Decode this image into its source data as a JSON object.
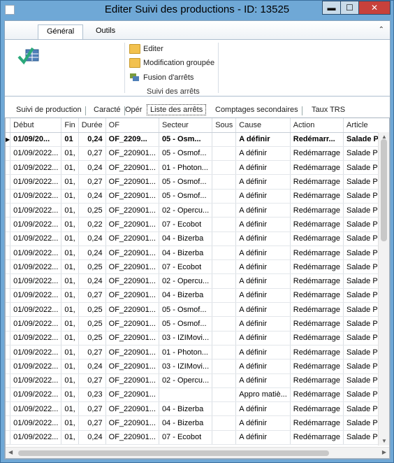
{
  "window": {
    "title": "Editer Suivi des productions - ID: 13525",
    "buttons": {
      "minimize": "▬",
      "maximize": "☐",
      "close": "✕"
    }
  },
  "ribbon": {
    "tabs": [
      "Général",
      "Outils"
    ],
    "items": [
      "Editer",
      "Modification groupée",
      "Fusion d'arrêts"
    ],
    "group_label": "Suivi des arrêts",
    "icons": [
      "checkmark-table-icon",
      "folder-icon",
      "folder-icon",
      "fusion-icon"
    ]
  },
  "page_tabs": [
    "Suivi de production",
    "Caracté",
    "Opér",
    "Liste des arrêts",
    "Comptages secondaires",
    "Taux TRS"
  ],
  "grid": {
    "columns": [
      "Début",
      "Fin",
      "Durée",
      "OF",
      "Secteur",
      "Sous",
      "Cause",
      "Action",
      "Article"
    ],
    "rows": [
      {
        "debut": "01/09/20...",
        "fin": "01",
        "duree": "0,24",
        "of": "OF_2209...",
        "secteur": "05 - Osm...",
        "sous": "",
        "cause": "A définir",
        "action": "Redémarr...",
        "article": "Salade Po"
      },
      {
        "debut": "01/09/2022...",
        "fin": "01,",
        "duree": "0,27",
        "of": "OF_220901...",
        "secteur": "05 - Osmof...",
        "sous": "",
        "cause": "A définir",
        "action": "Redémarrage",
        "article": "Salade Poul"
      },
      {
        "debut": "01/09/2022...",
        "fin": "01,",
        "duree": "0,24",
        "of": "OF_220901...",
        "secteur": "01 - Photon...",
        "sous": "",
        "cause": "A définir",
        "action": "Redémarrage",
        "article": "Salade Poul"
      },
      {
        "debut": "01/09/2022...",
        "fin": "01,",
        "duree": "0,27",
        "of": "OF_220901...",
        "secteur": "05 - Osmof...",
        "sous": "",
        "cause": "A définir",
        "action": "Redémarrage",
        "article": "Salade Poul"
      },
      {
        "debut": "01/09/2022...",
        "fin": "01,",
        "duree": "0,24",
        "of": "OF_220901...",
        "secteur": "05 - Osmof...",
        "sous": "",
        "cause": "A définir",
        "action": "Redémarrage",
        "article": "Salade Poul"
      },
      {
        "debut": "01/09/2022...",
        "fin": "01,",
        "duree": "0,25",
        "of": "OF_220901...",
        "secteur": "02 - Opercu...",
        "sous": "",
        "cause": "A définir",
        "action": "Redémarrage",
        "article": "Salade Poul"
      },
      {
        "debut": "01/09/2022...",
        "fin": "01,",
        "duree": "0,22",
        "of": "OF_220901...",
        "secteur": "07 - Ecobot",
        "sous": "",
        "cause": "A définir",
        "action": "Redémarrage",
        "article": "Salade Poul"
      },
      {
        "debut": "01/09/2022...",
        "fin": "01,",
        "duree": "0,24",
        "of": "OF_220901...",
        "secteur": "04 - Bizerba",
        "sous": "",
        "cause": "A définir",
        "action": "Redémarrage",
        "article": "Salade Poul"
      },
      {
        "debut": "01/09/2022...",
        "fin": "01,",
        "duree": "0,24",
        "of": "OF_220901...",
        "secteur": "04 - Bizerba",
        "sous": "",
        "cause": "A définir",
        "action": "Redémarrage",
        "article": "Salade Poul"
      },
      {
        "debut": "01/09/2022...",
        "fin": "01,",
        "duree": "0,25",
        "of": "OF_220901...",
        "secteur": "07 - Ecobot",
        "sous": "",
        "cause": "A définir",
        "action": "Redémarrage",
        "article": "Salade Poul"
      },
      {
        "debut": "01/09/2022...",
        "fin": "01,",
        "duree": "0,24",
        "of": "OF_220901...",
        "secteur": "02 - Opercu...",
        "sous": "",
        "cause": "A définir",
        "action": "Redémarrage",
        "article": "Salade Poul"
      },
      {
        "debut": "01/09/2022...",
        "fin": "01,",
        "duree": "0,27",
        "of": "OF_220901...",
        "secteur": "04 - Bizerba",
        "sous": "",
        "cause": "A définir",
        "action": "Redémarrage",
        "article": "Salade Poul"
      },
      {
        "debut": "01/09/2022...",
        "fin": "01,",
        "duree": "0,25",
        "of": "OF_220901...",
        "secteur": "05 - Osmof...",
        "sous": "",
        "cause": "A définir",
        "action": "Redémarrage",
        "article": "Salade Poul"
      },
      {
        "debut": "01/09/2022...",
        "fin": "01,",
        "duree": "0,25",
        "of": "OF_220901...",
        "secteur": "05 - Osmof...",
        "sous": "",
        "cause": "A définir",
        "action": "Redémarrage",
        "article": "Salade Poul"
      },
      {
        "debut": "01/09/2022...",
        "fin": "01,",
        "duree": "0,25",
        "of": "OF_220901...",
        "secteur": "03 - IZIMovi...",
        "sous": "",
        "cause": "A définir",
        "action": "Redémarrage",
        "article": "Salade Poul"
      },
      {
        "debut": "01/09/2022...",
        "fin": "01,",
        "duree": "0,27",
        "of": "OF_220901...",
        "secteur": "01 - Photon...",
        "sous": "",
        "cause": "A définir",
        "action": "Redémarrage",
        "article": "Salade Poul"
      },
      {
        "debut": "01/09/2022...",
        "fin": "01,",
        "duree": "0,24",
        "of": "OF_220901...",
        "secteur": "03 - IZIMovi...",
        "sous": "",
        "cause": "A définir",
        "action": "Redémarrage",
        "article": "Salade Poul"
      },
      {
        "debut": "01/09/2022...",
        "fin": "01,",
        "duree": "0,27",
        "of": "OF_220901...",
        "secteur": "02 - Opercu...",
        "sous": "",
        "cause": "A définir",
        "action": "Redémarrage",
        "article": "Salade Poul"
      },
      {
        "debut": "01/09/2022...",
        "fin": "01,",
        "duree": "0,23",
        "of": "OF_220901...",
        "secteur": "",
        "sous": "",
        "cause": "Appro matiè...",
        "action": "Redémarrage",
        "article": "Salade Poul"
      },
      {
        "debut": "01/09/2022...",
        "fin": "01,",
        "duree": "0,27",
        "of": "OF_220901...",
        "secteur": "04 - Bizerba",
        "sous": "",
        "cause": "A définir",
        "action": "Redémarrage",
        "article": "Salade Poul"
      },
      {
        "debut": "01/09/2022...",
        "fin": "01,",
        "duree": "0,27",
        "of": "OF_220901...",
        "secteur": "04 - Bizerba",
        "sous": "",
        "cause": "A définir",
        "action": "Redémarrage",
        "article": "Salade Poul"
      },
      {
        "debut": "01/09/2022...",
        "fin": "01,",
        "duree": "0,24",
        "of": "OF_220901...",
        "secteur": "07 - Ecobot",
        "sous": "",
        "cause": "A définir",
        "action": "Redémarrage",
        "article": "Salade Poul"
      }
    ]
  }
}
